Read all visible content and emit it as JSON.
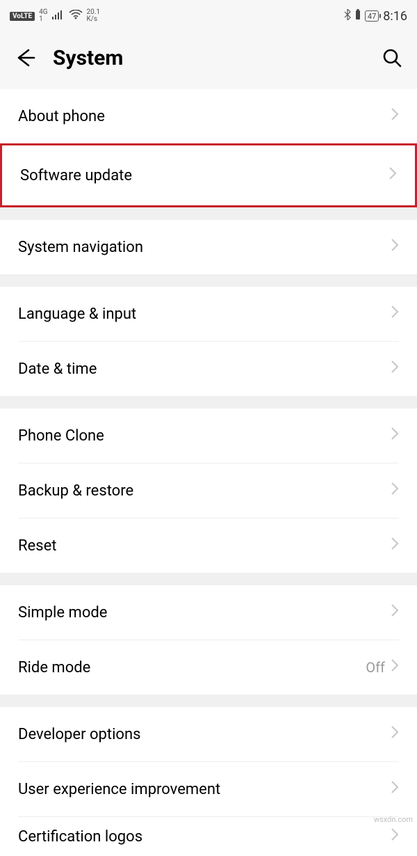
{
  "statusbar": {
    "volte": "VoLTE",
    "net_small_top": "4G",
    "net_small_bottom": "1",
    "speed_top": "20.1",
    "speed_bottom": "K/s",
    "battery": "47",
    "time": "8:16"
  },
  "header": {
    "title": "System"
  },
  "rows": {
    "about": "About phone",
    "software_update": "Software update",
    "system_nav": "System navigation",
    "language": "Language & input",
    "date_time": "Date & time",
    "phone_clone": "Phone Clone",
    "backup": "Backup & restore",
    "reset": "Reset",
    "simple_mode": "Simple mode",
    "ride_mode": "Ride mode",
    "ride_mode_value": "Off",
    "developer": "Developer options",
    "ux_improve": "User experience improvement",
    "cert_logos": "Certification logos"
  },
  "watermark": "wsxdn.com"
}
